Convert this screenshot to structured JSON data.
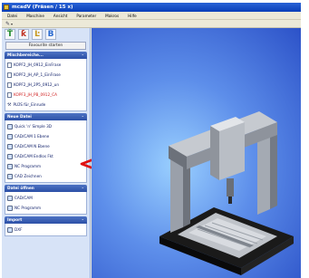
{
  "window": {
    "title": "mcadV (Fräsen / 15 x)"
  },
  "menu": {
    "items": [
      "Datei",
      "Maschine",
      "Ansicht",
      "Parameter",
      "Makros",
      "Hilfe"
    ]
  },
  "sidebar": {
    "favorites_label": "Favourite starten",
    "sections": [
      {
        "title": "Mischbereiche...",
        "items": [
          {
            "label": "KOPF2_JH_0912_EinFrase",
            "icon": "file-icon",
            "highlight": false
          },
          {
            "label": "KOPF2_JH_AP_1_EinFrase",
            "icon": "file-icon",
            "highlight": false
          },
          {
            "label": "KOPF2_JH_2P5_0912_un",
            "icon": "file-icon",
            "highlight": false
          },
          {
            "label": "KOPF3_JH_PB_0912_CA",
            "icon": "file-icon",
            "highlight": true
          },
          {
            "label": "PLÜS für_Einrude",
            "icon": "wrench-icon",
            "highlight": false
          }
        ]
      },
      {
        "title": "Neue Datei",
        "items": [
          {
            "label": "Quick 'n' Simple 3D",
            "icon": "document-icon"
          },
          {
            "label": "CAD/CAM 1 Ebene",
            "icon": "document-icon"
          },
          {
            "label": "CAD/CAM N Ebene",
            "icon": "document-icon"
          },
          {
            "label": "CAD/CAM Endlos Fkt",
            "icon": "document-icon"
          },
          {
            "label": "NC Programm",
            "icon": "document-icon"
          },
          {
            "label": "CAD Zeichnen",
            "icon": "document-icon"
          }
        ]
      },
      {
        "title": "Datei öffnen",
        "items": [
          {
            "label": "CAD/CAM",
            "icon": "document-icon"
          },
          {
            "label": "NC Programm",
            "icon": "document-icon"
          }
        ]
      },
      {
        "title": "Import",
        "items": [
          {
            "label": "DXF",
            "icon": "document-icon"
          }
        ]
      }
    ]
  },
  "colors": {
    "title_bar": "#0a3fb8",
    "section_header": "#2c50a6",
    "marker_arrow": "#e01010",
    "highlight_text": "#d02020"
  }
}
